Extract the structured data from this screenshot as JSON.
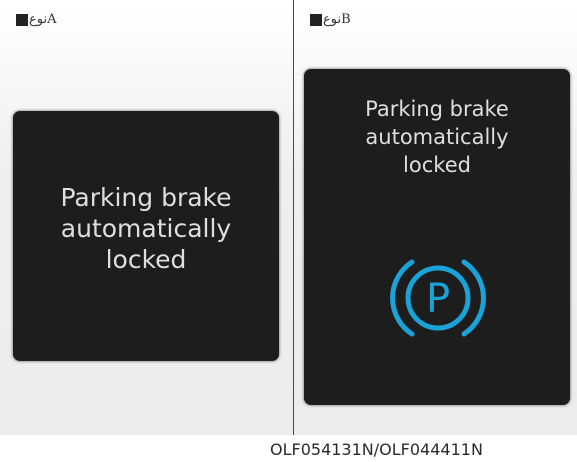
{
  "panel_a": {
    "type_label": "نوعA",
    "message": "Parking brake\nautomatically\nlocked"
  },
  "panel_b": {
    "type_label": "نوعB",
    "message": "Parking brake\nautomatically\nlocked",
    "icon": "parking-brake-icon",
    "icon_letter": "P",
    "icon_color": "#1aa3d9"
  },
  "figure_code": "OLF054131N/OLF044411N"
}
